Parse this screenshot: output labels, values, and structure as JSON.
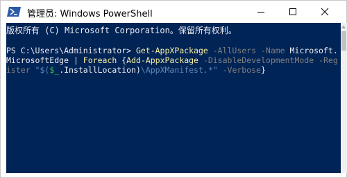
{
  "window": {
    "title": "管理员: Windows PowerShell"
  },
  "console": {
    "line1": "版权所有 (C) Microsoft Corporation。保留所有权利。",
    "line2": {
      "prompt": "PS C:\\Users\\Administrator> ",
      "cmd1": "Get-AppXPackage",
      "p1": " -AllUsers",
      "p2": " -Name",
      "arg1": " Microsoft."
    },
    "line3": {
      "arg1_cont": "MicrosoftEdge",
      "pipe": " | ",
      "cmd2": "Foreach",
      "brace": " {",
      "cmd3": "Add-AppxPackage",
      "p3": " -DisableDevelopmentMode",
      "p4": " -Reg"
    },
    "line4": {
      "p4_cont": "ister",
      "s1": " \"$(",
      "var": "$_",
      "s2": ".InstallLocation)",
      "s3": "\\AppXManifest.*\"",
      "p5": " -Verbose",
      "brace_close": "}"
    }
  },
  "colors": {
    "console_bg": "#012456",
    "text": "#eeedf0",
    "command": "#f9f1a5",
    "parameter": "#808080",
    "string": "#5f87b7",
    "variable": "#3dc23d"
  }
}
